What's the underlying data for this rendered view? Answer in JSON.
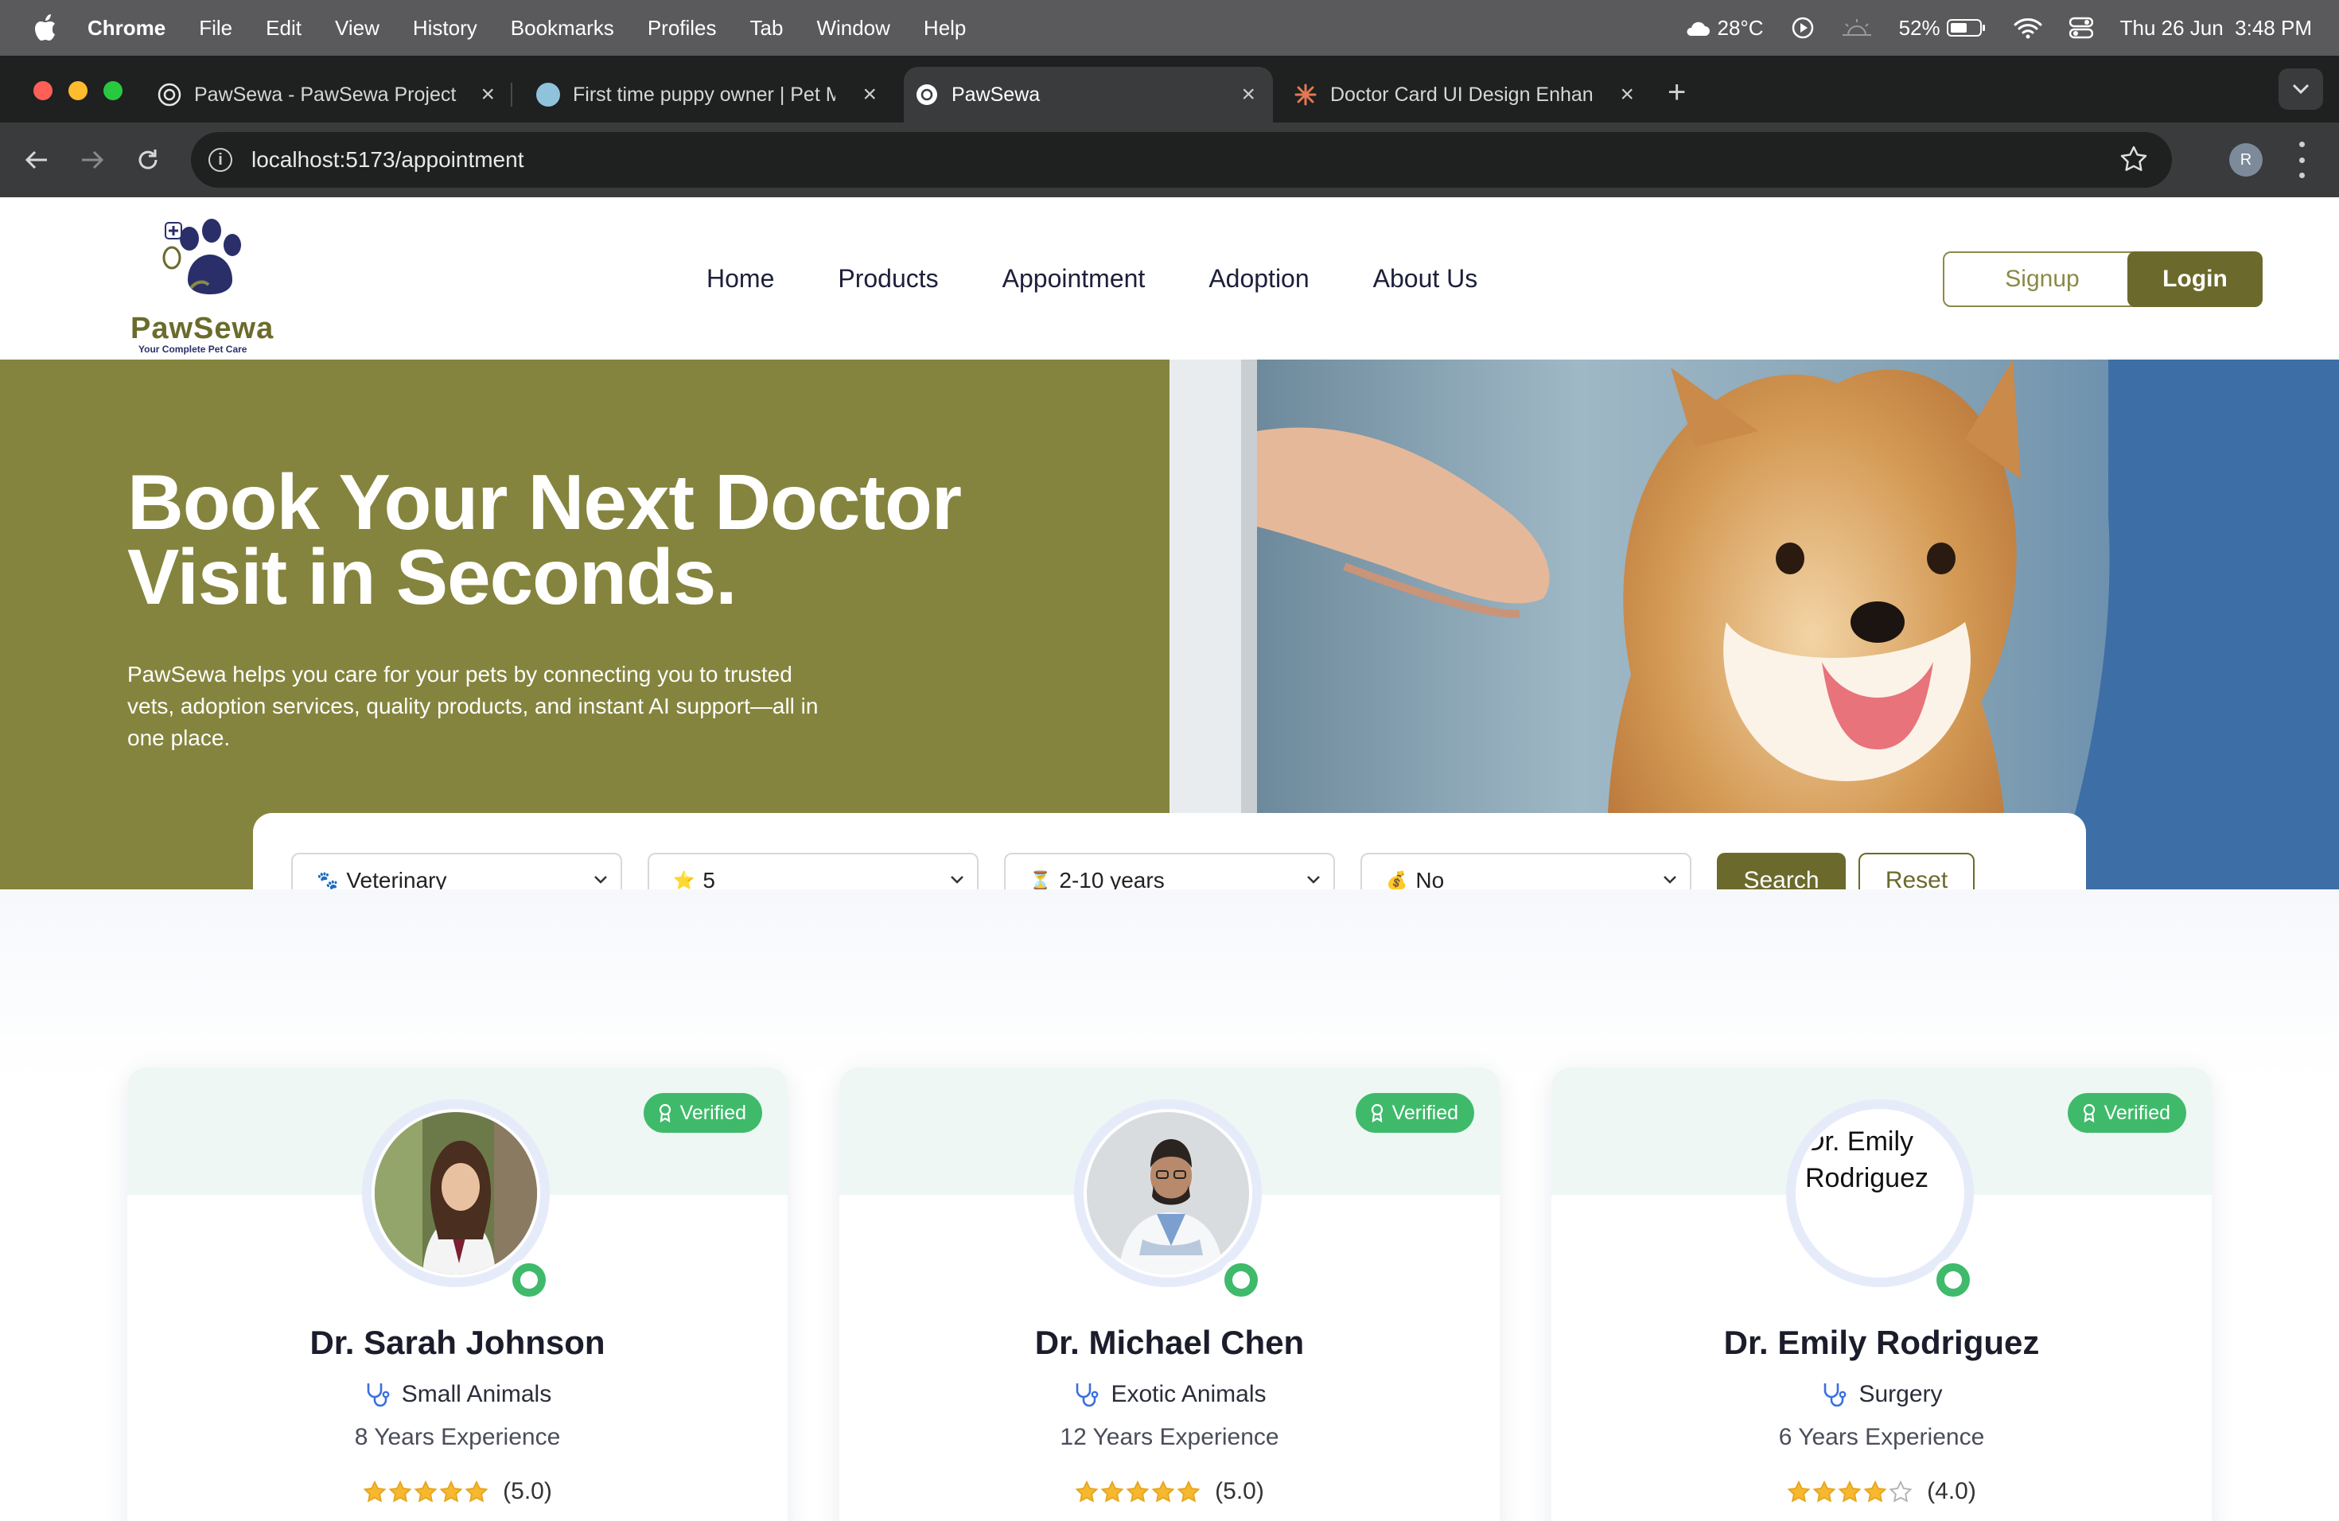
{
  "os_menubar": {
    "app": "Chrome",
    "menus": [
      "File",
      "Edit",
      "View",
      "History",
      "Bookmarks",
      "Profiles",
      "Tab",
      "Window",
      "Help"
    ],
    "weather": "28°C",
    "battery": "52%",
    "clock": "Thu 26 Jun  3:48 PM"
  },
  "browser": {
    "tabs": [
      {
        "title": "PawSewa - PawSewa Project",
        "icon": "openai-icon",
        "active": false
      },
      {
        "title": "First time puppy owner | Pet M",
        "icon": "puppy-site-icon",
        "active": false
      },
      {
        "title": "PawSewa",
        "icon": "openai-icon",
        "active": true
      },
      {
        "title": "Doctor Card UI Design Enhan",
        "icon": "claude-icon",
        "active": false
      }
    ],
    "url": "localhost:5173/appointment",
    "profile_initial": "R"
  },
  "site": {
    "logo_name": "PawSewa",
    "logo_tagline": "Your Complete Pet Care",
    "nav": [
      "Home",
      "Products",
      "Appointment",
      "Adoption",
      "About Us"
    ],
    "signup": "Signup",
    "login": "Login",
    "colors": {
      "brand_olive": "#84843e",
      "brand_dark": "#6b6a2c",
      "verified_green": "#3fba6b"
    }
  },
  "hero": {
    "title": "Book Your Next Doctor Visit in Seconds.",
    "subtitle": "PawSewa helps you care for your pets by connecting you to trusted vets, adoption services, quality products, and instant AI support—all in one place."
  },
  "search": {
    "filters": [
      {
        "icon": "paw-icon",
        "value": "Veterinary"
      },
      {
        "icon": "star-icon",
        "value": "5"
      },
      {
        "icon": "hourglass-icon",
        "value": "2-10 years"
      },
      {
        "icon": "money-bag-icon",
        "value": "No"
      }
    ],
    "search_label": "Search",
    "reset_label": "Reset"
  },
  "doctors": [
    {
      "name": "Dr. Sarah Johnson",
      "specialty": "Small Animals",
      "experience": "8 Years Experience",
      "rating": 5,
      "rating_text": "(5.0)",
      "badge": "Verified",
      "photo_alt": ""
    },
    {
      "name": "Dr. Michael Chen",
      "specialty": "Exotic Animals",
      "experience": "12 Years Experience",
      "rating": 5,
      "rating_text": "(5.0)",
      "badge": "Verified",
      "photo_alt": ""
    },
    {
      "name": "Dr. Emily Rodriguez",
      "specialty": "Surgery",
      "experience": "6 Years Experience",
      "rating": 4,
      "rating_text": "(4.0)",
      "badge": "Verified",
      "photo_alt": "Dr. Emily Rodriguez"
    }
  ]
}
